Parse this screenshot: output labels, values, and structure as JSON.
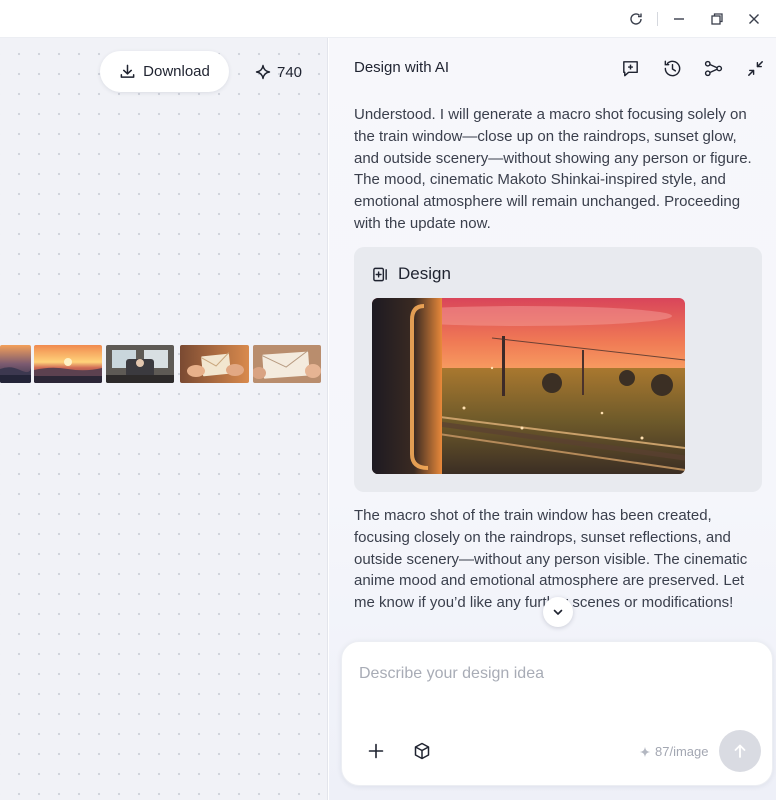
{
  "titlebar": {
    "buttons": [
      "refresh-icon",
      "minimize-icon",
      "restore-icon",
      "close-icon"
    ]
  },
  "canvas": {
    "download_label": "Download",
    "credits": "740",
    "thumbnails": [
      "coastal-sunset",
      "sunset-lake",
      "train-interior",
      "letter-hands",
      "envelope-hands"
    ]
  },
  "panel": {
    "title": "Design with AI",
    "header_icons": [
      "new-chat-icon",
      "history-icon",
      "share-icon",
      "collapse-icon"
    ],
    "messages": [
      "Understood. I will generate a macro shot focusing solely on the train window—close up on the raindrops, sunset glow, and outside scenery—without showing any person or figure. The mood, cinematic Makoto Shinkai-inspired style, and emotional atmosphere will remain unchanged. Proceeding with the update now.",
      "The macro shot of the train window has been created, focusing closely on the raindrops, sunset reflections, and outside scenery—without any person visible. The cinematic anime mood and emotional atmosphere are preserved. Let me know if you’d like any further scenes or modifications!"
    ],
    "design_card": {
      "label": "Design"
    },
    "composer": {
      "placeholder": "Describe your design idea",
      "value": "",
      "cost": "87/image"
    }
  },
  "colors": {
    "canvas_bg": "#f1f2f7",
    "panel_bg": "#f7f7fb",
    "card_bg": "#e8eaef",
    "send_disabled": "#d9dbe2",
    "text": "#1f2330"
  }
}
